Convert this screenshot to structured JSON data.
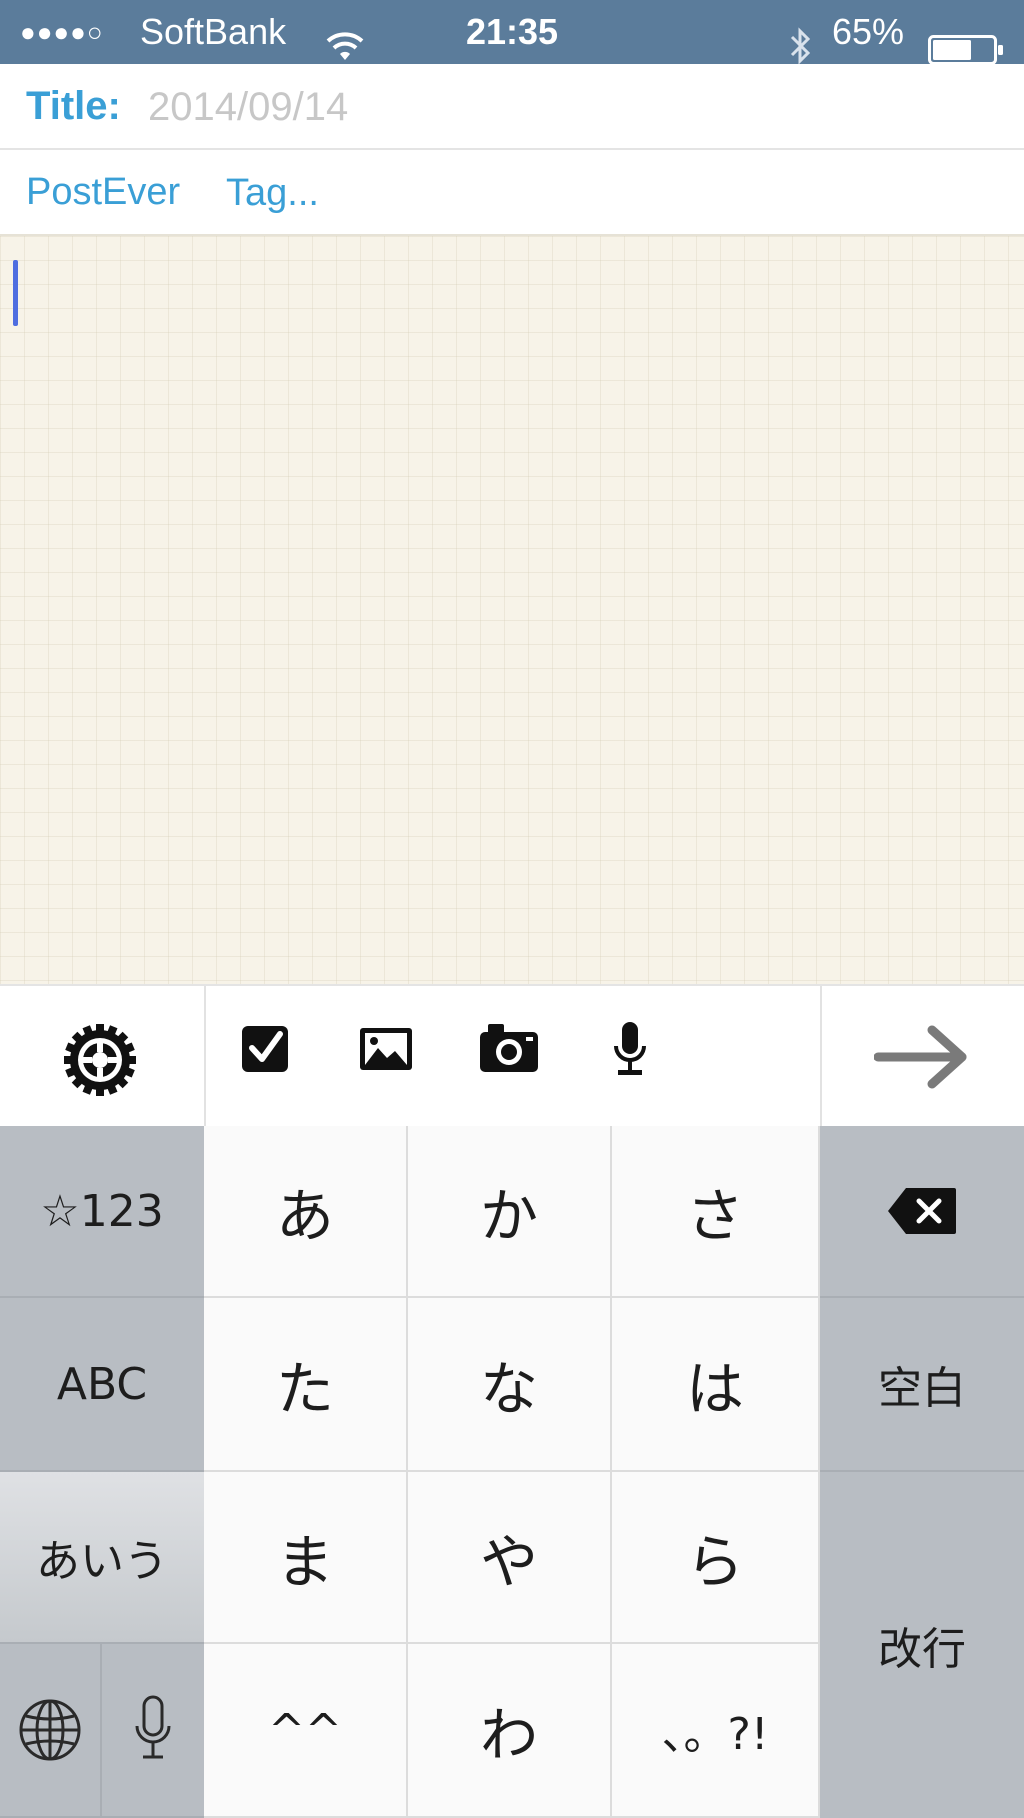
{
  "status_bar": {
    "signal": "●●●●○",
    "carrier": "SoftBank",
    "time": "21:35",
    "battery_percent": "65%",
    "battery_level": 0.65
  },
  "note": {
    "title_label": "Title:",
    "title_placeholder": "2014/09/14",
    "notebook": "PostEver",
    "tag_placeholder": "Tag...",
    "body": ""
  },
  "toolbar": {
    "icons": [
      "gear-icon",
      "checkbox-icon",
      "photo-icon",
      "camera-icon",
      "microphone-icon",
      "arrow-right-icon"
    ]
  },
  "keyboard": {
    "mode_key": "☆123",
    "abc_key": "ABC",
    "kana_mode_key": "あいう",
    "space_key": "空白",
    "return_key": "改行",
    "row1": [
      "あ",
      "か",
      "さ"
    ],
    "row2": [
      "た",
      "な",
      "は"
    ],
    "row3": [
      "ま",
      "や",
      "ら"
    ],
    "row4": [
      "^^",
      "わ",
      "、。?!"
    ]
  }
}
